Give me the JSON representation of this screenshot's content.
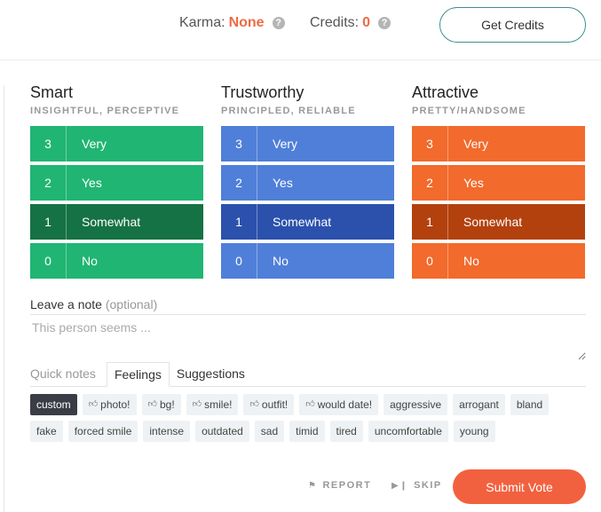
{
  "header": {
    "karma_label": "Karma:",
    "karma_value": "None",
    "credits_label": "Credits:",
    "credits_value": "0",
    "help_glyph": "?",
    "get_credits_label": "Get Credits"
  },
  "columns": [
    {
      "title": "Smart",
      "subtitle": "INSIGHTFUL, PERCEPTIVE",
      "color": "#20b573",
      "selected_color": "#157244",
      "selected_value": 1,
      "options": [
        {
          "num": "3",
          "label": "Very"
        },
        {
          "num": "2",
          "label": "Yes"
        },
        {
          "num": "1",
          "label": "Somewhat"
        },
        {
          "num": "0",
          "label": "No"
        }
      ]
    },
    {
      "title": "Trustworthy",
      "subtitle": "PRINCIPLED, RELIABLE",
      "color": "#4f7fd8",
      "selected_color": "#2b51ad",
      "selected_value": 1,
      "options": [
        {
          "num": "3",
          "label": "Very"
        },
        {
          "num": "2",
          "label": "Yes"
        },
        {
          "num": "1",
          "label": "Somewhat"
        },
        {
          "num": "0",
          "label": "No"
        }
      ]
    },
    {
      "title": "Attractive",
      "subtitle": "PRETTY/HANDSOME",
      "color": "#f26a2c",
      "selected_color": "#b3410e",
      "selected_value": 1,
      "options": [
        {
          "num": "3",
          "label": "Very"
        },
        {
          "num": "2",
          "label": "Yes"
        },
        {
          "num": "1",
          "label": "Somewhat"
        },
        {
          "num": "0",
          "label": "No"
        }
      ]
    }
  ],
  "note": {
    "label": "Leave a note",
    "optional": "(optional)",
    "placeholder": "This person seems ..."
  },
  "tabs": {
    "quick_notes": "Quick notes",
    "feelings": "Feelings",
    "suggestions": "Suggestions",
    "active": "feelings"
  },
  "chips": [
    {
      "label": "custom",
      "thumb": false,
      "selected": true
    },
    {
      "label": "photo!",
      "thumb": true,
      "selected": false
    },
    {
      "label": "bg!",
      "thumb": true,
      "selected": false
    },
    {
      "label": "smile!",
      "thumb": true,
      "selected": false
    },
    {
      "label": "outfit!",
      "thumb": true,
      "selected": false
    },
    {
      "label": "would date!",
      "thumb": true,
      "selected": false
    },
    {
      "label": "aggressive",
      "thumb": false,
      "selected": false
    },
    {
      "label": "arrogant",
      "thumb": false,
      "selected": false
    },
    {
      "label": "bland",
      "thumb": false,
      "selected": false
    },
    {
      "label": "fake",
      "thumb": false,
      "selected": false
    },
    {
      "label": "forced smile",
      "thumb": false,
      "selected": false
    },
    {
      "label": "intense",
      "thumb": false,
      "selected": false
    },
    {
      "label": "outdated",
      "thumb": false,
      "selected": false
    },
    {
      "label": "sad",
      "thumb": false,
      "selected": false
    },
    {
      "label": "timid",
      "thumb": false,
      "selected": false
    },
    {
      "label": "tired",
      "thumb": false,
      "selected": false
    },
    {
      "label": "uncomfortable",
      "thumb": false,
      "selected": false
    },
    {
      "label": "young",
      "thumb": false,
      "selected": false
    }
  ],
  "footer": {
    "report_label": "REPORT",
    "skip_label": "SKIP",
    "submit_label": "Submit Vote",
    "submit_color": "#f2613f"
  },
  "icons": {
    "help": "question-circle-icon",
    "thumb": "thumbs-up-icon",
    "report": "flag-icon",
    "skip": "skip-forward-icon"
  }
}
